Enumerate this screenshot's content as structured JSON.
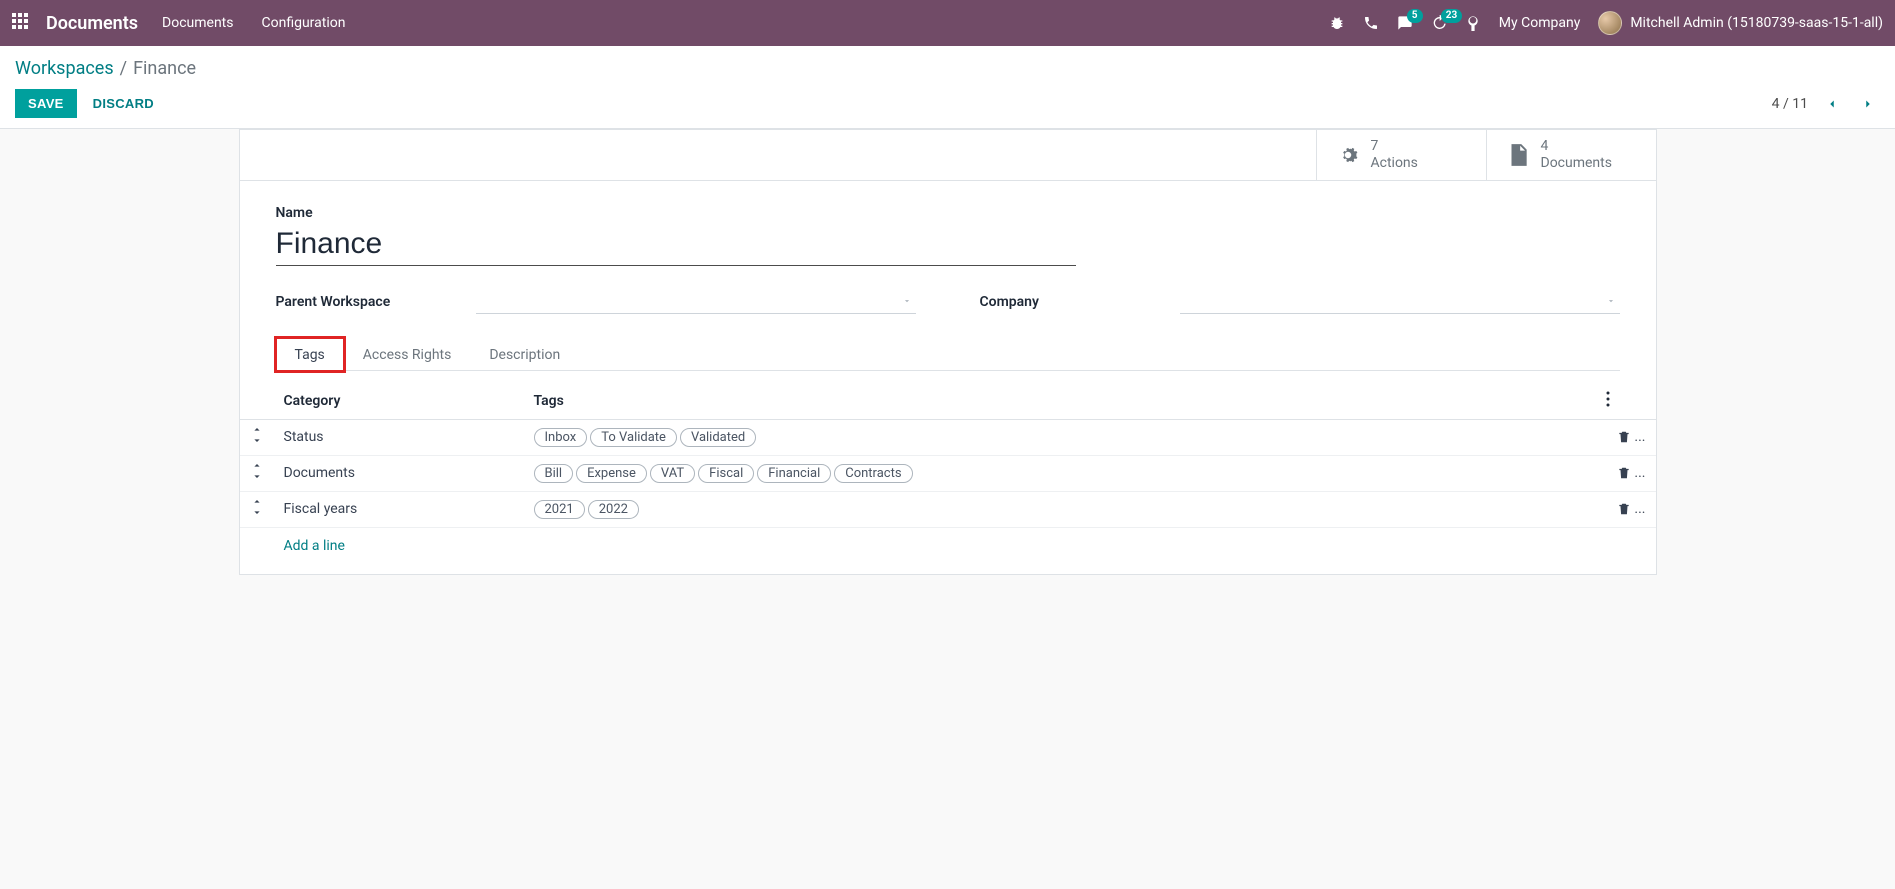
{
  "navbar": {
    "brand": "Documents",
    "links": [
      "Documents",
      "Configuration"
    ],
    "badges": {
      "messages": "5",
      "activities": "23"
    },
    "company": "My Company",
    "user": "Mitchell Admin (15180739-saas-15-1-all)"
  },
  "breadcrumb": {
    "root": "Workspaces",
    "current": "Finance"
  },
  "buttons": {
    "save": "Save",
    "discard": "Discard"
  },
  "pager": "4 / 11",
  "stats": {
    "actions": {
      "count": "7",
      "label": "Actions"
    },
    "documents": {
      "count": "4",
      "label": "Documents"
    }
  },
  "form": {
    "name_label": "Name",
    "name_value": "Finance",
    "parent_label": "Parent Workspace",
    "company_label": "Company"
  },
  "tabs": [
    "Tags",
    "Access Rights",
    "Description"
  ],
  "table": {
    "headers": {
      "category": "Category",
      "tags": "Tags"
    },
    "rows": [
      {
        "category": "Status",
        "tags": [
          "Inbox",
          "To Validate",
          "Validated"
        ]
      },
      {
        "category": "Documents",
        "tags": [
          "Bill",
          "Expense",
          "VAT",
          "Fiscal",
          "Financial",
          "Contracts"
        ]
      },
      {
        "category": "Fiscal years",
        "tags": [
          "2021",
          "2022"
        ]
      }
    ],
    "add_line": "Add a line"
  }
}
